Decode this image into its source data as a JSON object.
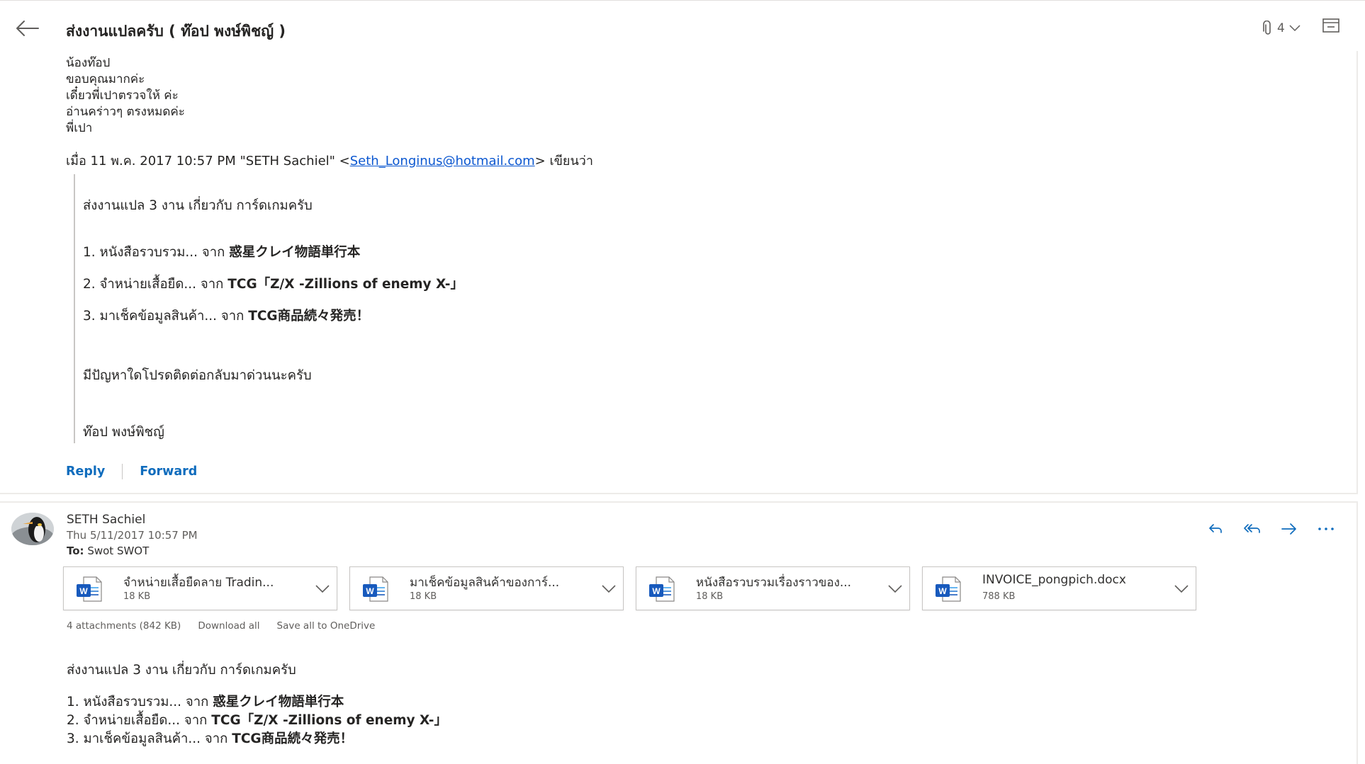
{
  "header": {
    "subject": "ส่งงานแปลครับ ( ท๊อป พงษ์พิชญ์ )",
    "attachment_count": "4"
  },
  "message1": {
    "reply_lines": [
      "น้องท๊อป",
      "ขอบคุณมากค่ะ",
      "เดี๋ยวพี่เปาตรวจให้ ค่ะ",
      "อ่านคร่าวๆ ตรงหมดค่ะ",
      "พี่เปา"
    ],
    "quote_header_prefix": "เมื่อ 11 พ.ค. 2017 10:57 PM \"SETH Sachiel\" <",
    "quote_header_email": "Seth_Longinus@hotmail.com",
    "quote_header_suffix": "> เขียนว่า",
    "quote": {
      "intro": "ส่งงานแปล 3 งาน เกี่ยวกับ การ์ดเกมครับ",
      "items": [
        {
          "prefix": "1. หนังสือรวบรวม...  จาก  ",
          "bold": "惑星クレイ物語単行本"
        },
        {
          "prefix": "2. จำหน่ายเสื้อยืด...  จาก   ",
          "bold": "TCG「Z/X -Zillions of enemy X-」"
        },
        {
          "prefix": "3. มาเช็คข้อมูลสินค้า...  จาก  ",
          "bold": "TCG商品続々発売！"
        }
      ],
      "contact": "มีปัญหาใดโปรดติดต่อกลับมาด่วนนะครับ",
      "signature": "ท๊อป พงษ์พิชญ์"
    },
    "reply_label": "Reply",
    "forward_label": "Forward"
  },
  "message2": {
    "sender": "SETH Sachiel",
    "datetime": "Thu 5/11/2017 10:57 PM",
    "to_label": "To:",
    "to_value": "Swot SWOT",
    "attachments": [
      {
        "name": "จำหน่ายเสื้อยืดลาย Tradin...",
        "size": "18 KB"
      },
      {
        "name": "มาเช็คข้อมูลสินค้าของการ์...",
        "size": "18 KB"
      },
      {
        "name": "หนังสือรวบรวมเรื่องราวของ...",
        "size": "18 KB"
      },
      {
        "name": "INVOICE_pongpich.docx",
        "size": "788 KB"
      }
    ],
    "attachment_summary": "4 attachments (842 KB)",
    "download_all": "Download all",
    "save_onedrive": "Save all to OneDrive",
    "body": {
      "intro": "ส่งงานแปล 3 งาน เกี่ยวกับ การ์ดเกมครับ",
      "items": [
        {
          "prefix": "1. หนังสือรวบรวม...  จาก  ",
          "bold": "惑星クレイ物語単行本"
        },
        {
          "prefix": "2. จำหน่ายเสื้อยืด...  จาก   ",
          "bold": "TCG「Z/X -Zillions of enemy X-」"
        },
        {
          "prefix": "3. มาเช็คข้อมูลสินค้า...  จาก  ",
          "bold": "TCG商品続々発売！"
        }
      ]
    }
  },
  "icons": {
    "back": "back-arrow-icon",
    "paperclip": "paperclip-icon",
    "popout": "popout-icon",
    "reply": "reply-icon",
    "reply_all": "reply-all-icon",
    "forward": "forward-icon",
    "more": "more-icon",
    "word": "word-doc-icon"
  },
  "colors": {
    "link": "#0f6cbd",
    "word_blue": "#185abd"
  }
}
